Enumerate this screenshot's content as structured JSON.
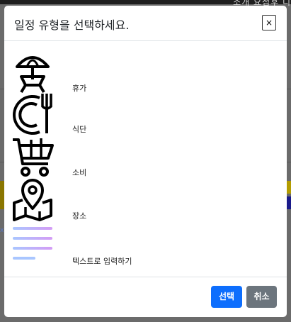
{
  "background": {
    "top_nav_text": "소개   요점후   니"
  },
  "modal": {
    "title": "일정 유형을 선택하세요.",
    "close_label": "×",
    "options": [
      {
        "label": "휴가",
        "icon": "beach-umbrella-icon"
      },
      {
        "label": "식단",
        "icon": "plate-fork-icon"
      },
      {
        "label": "소비",
        "icon": "shopping-cart-icon"
      },
      {
        "label": "장소",
        "icon": "map-pin-icon"
      },
      {
        "label": "텍스트로 입력하기",
        "icon": "text-lines-icon"
      }
    ],
    "select_label": "선택",
    "cancel_label": "취소"
  },
  "colors": {
    "primary": "#0d6efd",
    "secondary": "#6c757d",
    "text_line_blue": "#a9c6ff",
    "text_line_purple": "#d49cf5"
  }
}
